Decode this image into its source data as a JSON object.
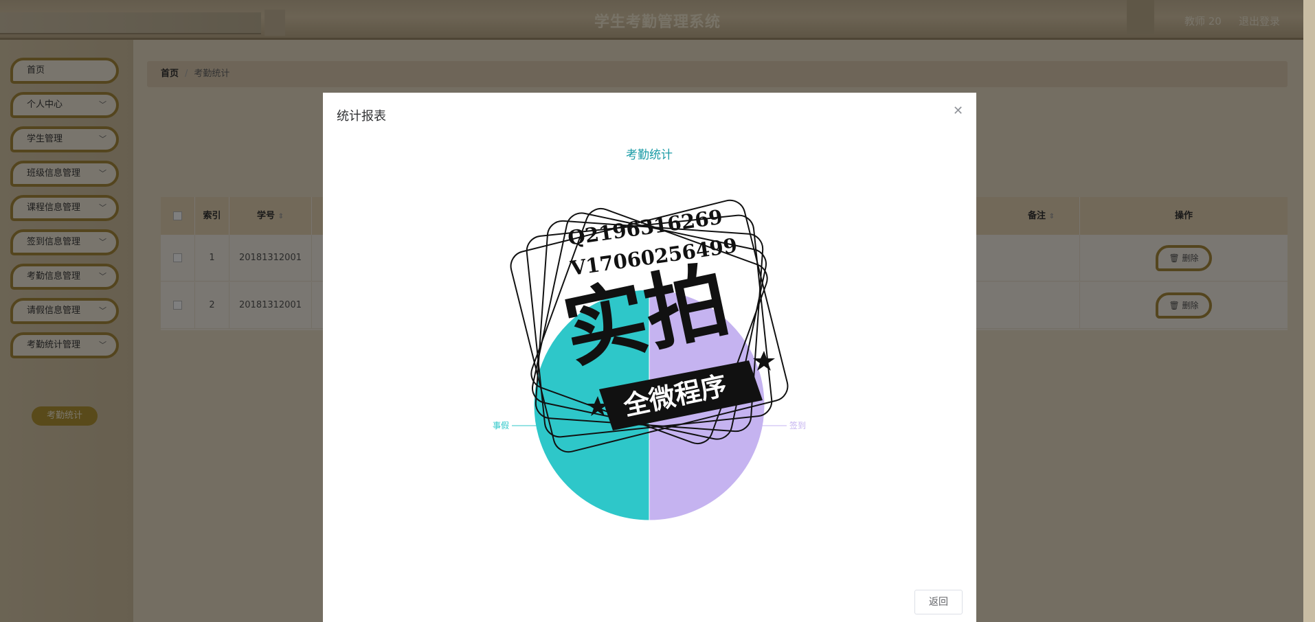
{
  "header": {
    "title": "学生考勤管理系统",
    "user": "教师 20",
    "logout": "退出登录"
  },
  "sidebar": {
    "items": [
      {
        "label": "首页",
        "has_children": false
      },
      {
        "label": "个人中心",
        "has_children": true
      },
      {
        "label": "学生管理",
        "has_children": true
      },
      {
        "label": "班级信息管理",
        "has_children": true
      },
      {
        "label": "课程信息管理",
        "has_children": true
      },
      {
        "label": "签到信息管理",
        "has_children": true
      },
      {
        "label": "考勤信息管理",
        "has_children": true
      },
      {
        "label": "请假信息管理",
        "has_children": true
      },
      {
        "label": "考勤统计管理",
        "has_children": true
      }
    ],
    "active_sub": "考勤统计"
  },
  "breadcrumb": {
    "home": "首页",
    "separator": "/",
    "current": "考勤统计"
  },
  "table": {
    "headers": {
      "index": "索引",
      "student_no": "学号",
      "remark": "备注",
      "actions": "操作"
    },
    "rows": [
      {
        "index": "1",
        "student_no": "20181312001",
        "remark": "",
        "delete": "删除"
      },
      {
        "index": "2",
        "student_no": "20181312001",
        "remark": "",
        "delete": "删除"
      }
    ]
  },
  "dialog": {
    "title": "统计报表",
    "back": "返回"
  },
  "chart_data": {
    "type": "pie",
    "title": "考勤统计",
    "slices": [
      {
        "name": "签到",
        "value": 50,
        "color": "#c5b3f0"
      },
      {
        "name": "事假",
        "value": 50,
        "color": "#2ec7c9"
      }
    ]
  },
  "stamp": {
    "line1": "Q2196316269",
    "line2": "V17060256499",
    "big": "实拍",
    "ribbon": "全微程序"
  },
  "colors": {
    "accent": "#a98a3c",
    "title": "#1a9ba6"
  }
}
